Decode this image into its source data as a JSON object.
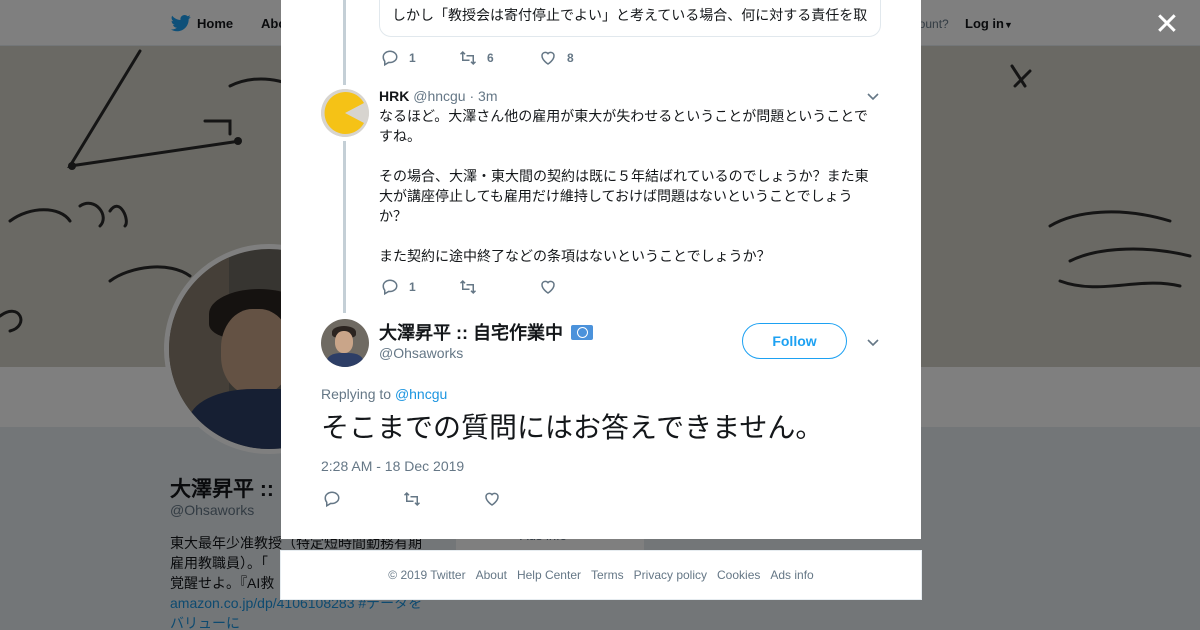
{
  "topnav": {
    "home": "Home",
    "about": "Abo",
    "have_account": "account?",
    "login": "Log in"
  },
  "profile": {
    "name": "大澤昇平 ::",
    "handle": "@Ohsaworks",
    "bio_lines": [
      "東大最年少准教授（特定短時間勤務有期",
      "雇用教職員）。「",
      "覚醒せよ。『AI救"
    ],
    "link_lines": [
      "amazon.co.jp/dp/4106108283 #データを",
      "バリューに"
    ],
    "card_text": "Ads info"
  },
  "thread": {
    "quoted_text": "しかし「教授会は寄付停止でよい」と考えている場合、何に対する責任を取",
    "first_actions": {
      "replies": "1",
      "retweets": "6",
      "likes": "8"
    },
    "reply": {
      "name": "HRK",
      "handle": "@hncgu",
      "time": "· 3m",
      "para1": "なるほど。大澤さん他の雇用が東大が失わせるということが問題ということですね。",
      "para2": "その場合、大澤・東大間の契約は既に５年結ばれているのでしょうか？また東大が講座停止しても雇用だけ維持しておけば問題はないということでしょうか？",
      "para3": "また契約に途中終了などの条項はないということでしょうか？",
      "actions": {
        "replies": "1",
        "retweets": "",
        "likes": ""
      }
    },
    "main": {
      "name": "大澤昇平 :: 自宅作業中",
      "handle": "@Ohsaworks",
      "follow_label": "Follow",
      "replying_to_prefix": "Replying to",
      "replying_to_handle": "@hncgu",
      "text": "そこまでの質問にはお答えできません。",
      "datetime": "2:28 AM - 18 Dec 2019"
    }
  },
  "footer": {
    "items": [
      "© 2019 Twitter",
      "About",
      "Help Center",
      "Terms",
      "Privacy policy",
      "Cookies",
      "Ads info"
    ]
  },
  "icons": {
    "close": "close-icon",
    "reply": "reply-icon",
    "retweet": "retweet-icon",
    "like": "heart-icon",
    "caret": "chevron-down-icon",
    "brand": "twitter-bird-icon"
  },
  "colors": {
    "accent": "#1da1f2",
    "link": "#1b95e0",
    "muted": "#657786",
    "text": "#14171a",
    "thread_line": "#c4cfd6",
    "badge": "#4b92db"
  }
}
